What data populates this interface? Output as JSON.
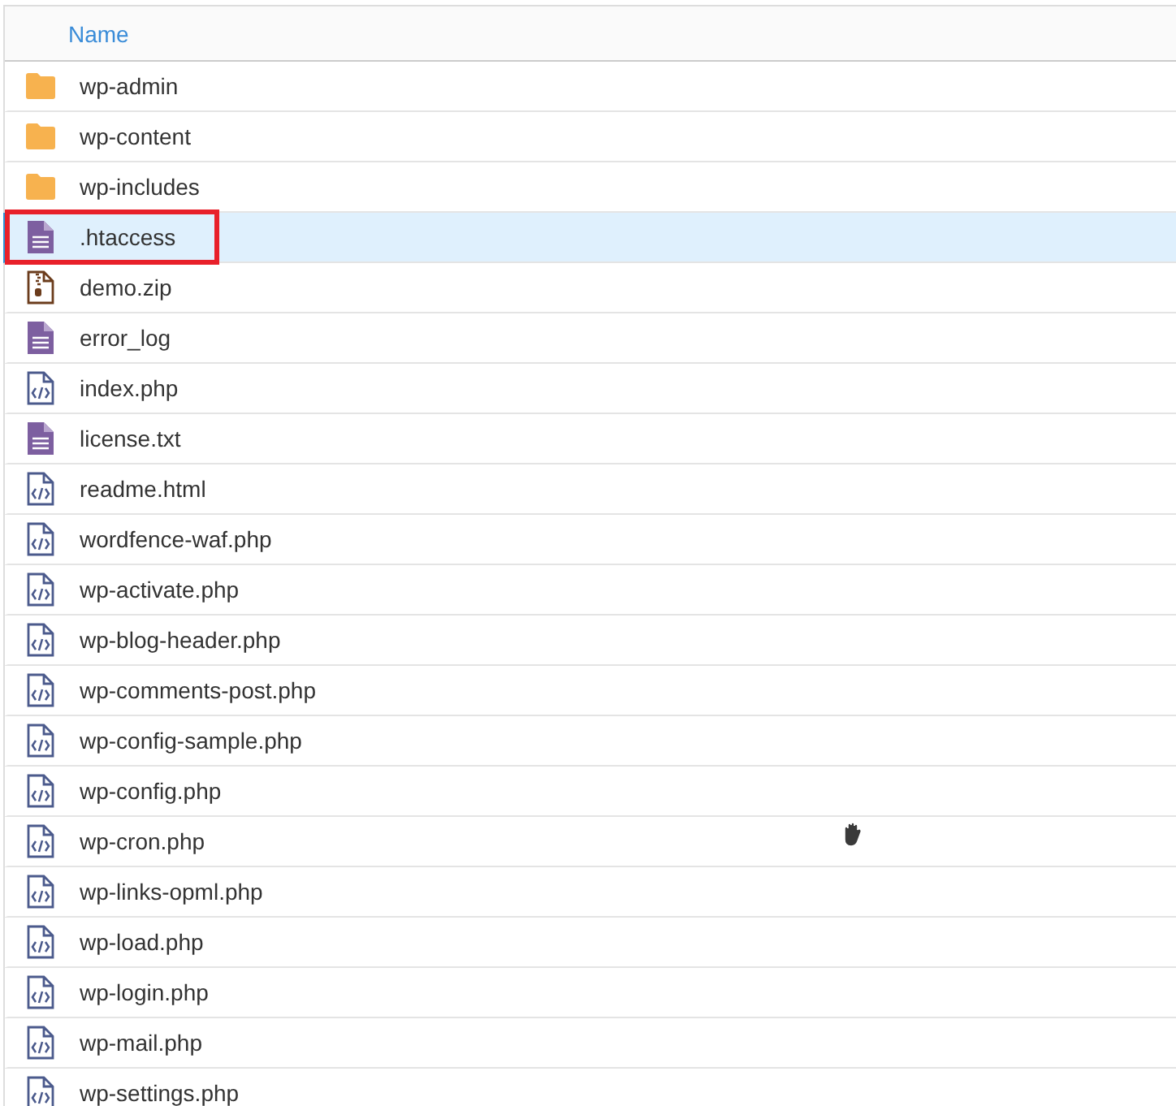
{
  "table": {
    "columns": [
      "Name"
    ],
    "rows": [
      {
        "kind": "folder",
        "name": "wp-admin",
        "selected": false,
        "outlined": false
      },
      {
        "kind": "folder",
        "name": "wp-content",
        "selected": false,
        "outlined": false
      },
      {
        "kind": "folder",
        "name": "wp-includes",
        "selected": false,
        "outlined": false
      },
      {
        "kind": "text",
        "name": ".htaccess",
        "selected": true,
        "outlined": true
      },
      {
        "kind": "zip",
        "name": "demo.zip",
        "selected": false,
        "outlined": false
      },
      {
        "kind": "text",
        "name": "error_log",
        "selected": false,
        "outlined": false
      },
      {
        "kind": "code",
        "name": "index.php",
        "selected": false,
        "outlined": false
      },
      {
        "kind": "text",
        "name": "license.txt",
        "selected": false,
        "outlined": false
      },
      {
        "kind": "code",
        "name": "readme.html",
        "selected": false,
        "outlined": false
      },
      {
        "kind": "code",
        "name": "wordfence-waf.php",
        "selected": false,
        "outlined": false
      },
      {
        "kind": "code",
        "name": "wp-activate.php",
        "selected": false,
        "outlined": false
      },
      {
        "kind": "code",
        "name": "wp-blog-header.php",
        "selected": false,
        "outlined": false
      },
      {
        "kind": "code",
        "name": "wp-comments-post.php",
        "selected": false,
        "outlined": false
      },
      {
        "kind": "code",
        "name": "wp-config-sample.php",
        "selected": false,
        "outlined": false
      },
      {
        "kind": "code",
        "name": "wp-config.php",
        "selected": false,
        "outlined": false
      },
      {
        "kind": "code",
        "name": "wp-cron.php",
        "selected": false,
        "outlined": false
      },
      {
        "kind": "code",
        "name": "wp-links-opml.php",
        "selected": false,
        "outlined": false
      },
      {
        "kind": "code",
        "name": "wp-load.php",
        "selected": false,
        "outlined": false
      },
      {
        "kind": "code",
        "name": "wp-login.php",
        "selected": false,
        "outlined": false
      },
      {
        "kind": "code",
        "name": "wp-mail.php",
        "selected": false,
        "outlined": false
      },
      {
        "kind": "code",
        "name": "wp-settings.php",
        "selected": false,
        "outlined": false
      }
    ]
  }
}
